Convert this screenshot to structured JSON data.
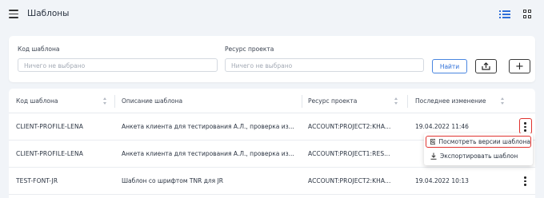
{
  "header": {
    "title": "Шаблоны",
    "icons": {
      "menu": "hamburger-icon",
      "list_view": "list-view-icon",
      "grid_view": "grid-view-icon"
    },
    "active_view": "list",
    "accent_color": "#2f6fd8"
  },
  "filters": {
    "code_label": "Код шаблона",
    "code_placeholder": "Ничего не выбрано",
    "resource_label": "Ресурс проекта",
    "resource_placeholder": "Ничего не выбрано",
    "find_label": "Найти",
    "icons": {
      "upload": "upload-icon",
      "add": "plus-icon"
    },
    "add_symbol": "+"
  },
  "table": {
    "columns": [
      "Код шаблона",
      "Описание шаблона",
      "Ресурс проекта",
      "Последнее изменение"
    ],
    "rows": [
      {
        "code": "CLIENT-PROFILE-LENA",
        "description": "Анкета клиента для тестирования А.Л., проверка из...",
        "resource": "ACCOUNT:PROJECT2:KHA...",
        "modified": "19.04.2022 11:46"
      },
      {
        "code": "CLIENT-PROFILE-LENA",
        "description": "Анкета клиента для тестирования А.Л., проверка из...",
        "resource": "ACCOUNT:PROJECT1:RES...",
        "modified": ""
      },
      {
        "code": "TEST-FONT-JR",
        "description": "Шаблон со шрифтом TNR для JR",
        "resource": "ACCOUNT:PROJECT2:KHA...",
        "modified": "19.04.2022 10:13"
      }
    ]
  },
  "context_menu": {
    "items": [
      {
        "label": "Посмотреть версии шаблона",
        "icon": "versions-icon"
      },
      {
        "label": "Экспортировать шаблон",
        "icon": "download-icon"
      }
    ],
    "highlight_color": "#e0332f"
  }
}
